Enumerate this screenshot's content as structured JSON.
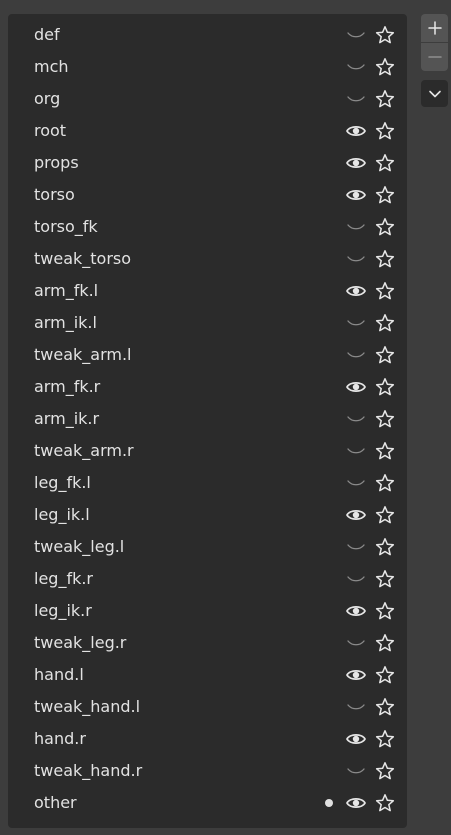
{
  "collections": [
    {
      "name": "def",
      "visible": false,
      "solo": false
    },
    {
      "name": "mch",
      "visible": false,
      "solo": false
    },
    {
      "name": "org",
      "visible": false,
      "solo": false
    },
    {
      "name": "root",
      "visible": true,
      "solo": false
    },
    {
      "name": "props",
      "visible": true,
      "solo": false
    },
    {
      "name": "torso",
      "visible": true,
      "solo": false
    },
    {
      "name": "torso_fk",
      "visible": false,
      "solo": false
    },
    {
      "name": "tweak_torso",
      "visible": false,
      "solo": false
    },
    {
      "name": "arm_fk.l",
      "visible": true,
      "solo": false
    },
    {
      "name": "arm_ik.l",
      "visible": false,
      "solo": false
    },
    {
      "name": "tweak_arm.l",
      "visible": false,
      "solo": false
    },
    {
      "name": "arm_fk.r",
      "visible": true,
      "solo": false
    },
    {
      "name": "arm_ik.r",
      "visible": false,
      "solo": false
    },
    {
      "name": "tweak_arm.r",
      "visible": false,
      "solo": false
    },
    {
      "name": "leg_fk.l",
      "visible": false,
      "solo": false
    },
    {
      "name": "leg_ik.l",
      "visible": true,
      "solo": false
    },
    {
      "name": "tweak_leg.l",
      "visible": false,
      "solo": false
    },
    {
      "name": "leg_fk.r",
      "visible": false,
      "solo": false
    },
    {
      "name": "leg_ik.r",
      "visible": true,
      "solo": false
    },
    {
      "name": "tweak_leg.r",
      "visible": false,
      "solo": false
    },
    {
      "name": "hand.l",
      "visible": true,
      "solo": false
    },
    {
      "name": "tweak_hand.l",
      "visible": false,
      "solo": false
    },
    {
      "name": "hand.r",
      "visible": true,
      "solo": false
    },
    {
      "name": "tweak_hand.r",
      "visible": false,
      "solo": false
    },
    {
      "name": "other",
      "visible": true,
      "solo": false,
      "active_dot": true
    }
  ],
  "icons": {
    "visible": "eye-open-icon",
    "hidden": "eye-closed-icon",
    "favorite": "star-outline-icon",
    "add": "plus-icon",
    "remove": "minus-icon",
    "menu": "chevron-down-icon",
    "active": "dot-icon"
  },
  "colors": {
    "background": "#3d3d3d",
    "panel": "#2b2b2b",
    "text": "#e2e2e2",
    "icon_on": "#e6e6e6",
    "icon_off": "#8a8a8a",
    "button": "#545454"
  }
}
